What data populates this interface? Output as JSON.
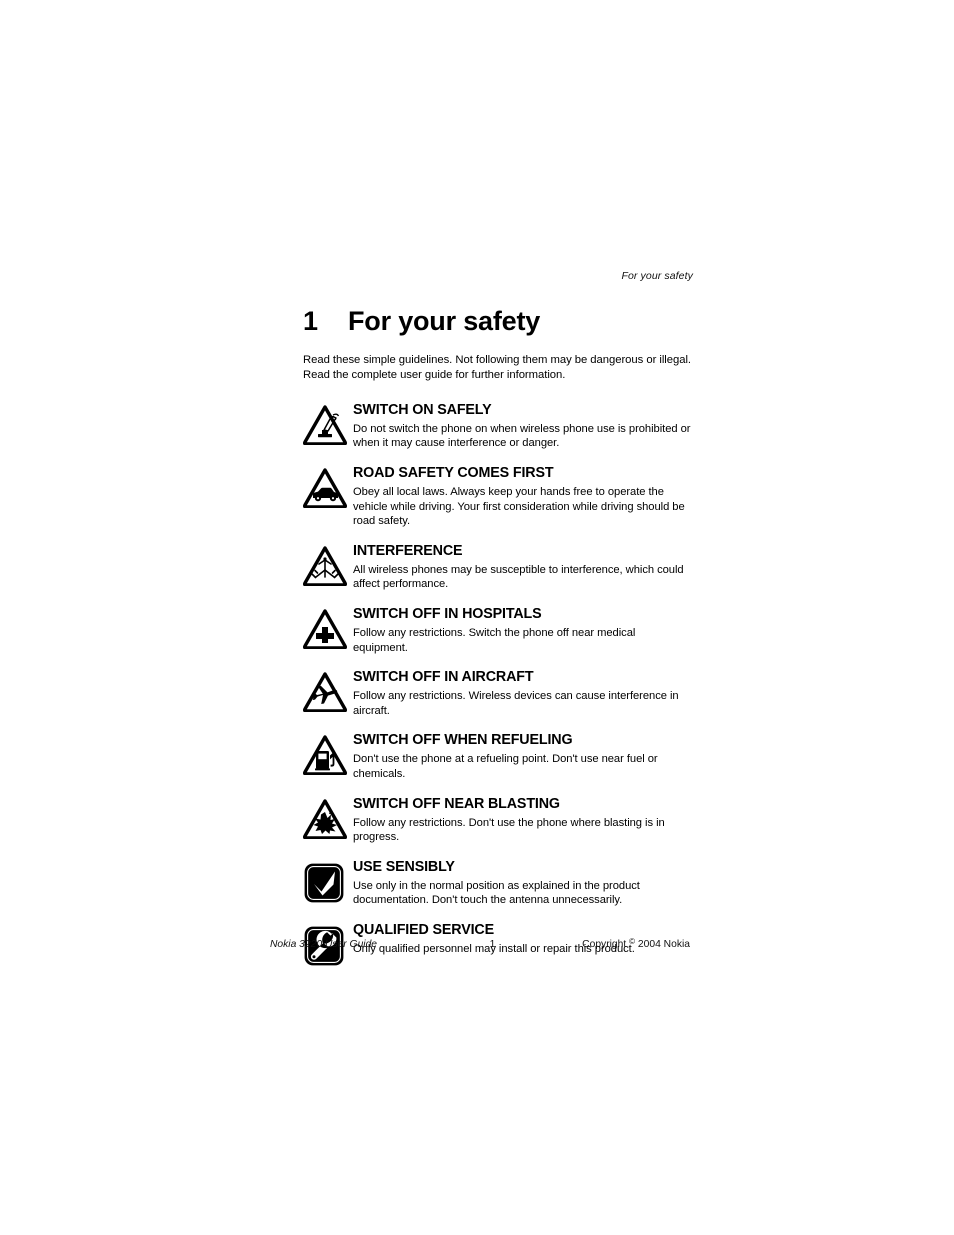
{
  "running_header": "For your safety",
  "chapter": {
    "number": "1",
    "title": "For your safety"
  },
  "intro": "Read these simple guidelines. Not following them may be dangerous or illegal. Read the complete user guide for further information.",
  "safety_items": [
    {
      "icon": "triangle-phone-hand-icon",
      "heading": "SWITCH ON SAFELY",
      "body": "Do not switch the phone on when wireless phone use is prohibited or when it may cause interference or danger."
    },
    {
      "icon": "triangle-car-icon",
      "heading": "ROAD SAFETY COMES FIRST",
      "body": "Obey all local laws. Always keep your hands free to operate the vehicle while driving. Your first consideration while driving should be road safety."
    },
    {
      "icon": "triangle-antenna-interference-icon",
      "heading": "INTERFERENCE",
      "body": "All wireless phones may be susceptible to interference, which could affect performance."
    },
    {
      "icon": "triangle-medical-cross-icon",
      "heading": "SWITCH OFF IN HOSPITALS",
      "body": "Follow any restrictions. Switch the phone off near medical equipment."
    },
    {
      "icon": "triangle-airplane-icon",
      "heading": "SWITCH OFF IN AIRCRAFT",
      "body": "Follow any restrictions. Wireless devices can cause interference in aircraft."
    },
    {
      "icon": "triangle-fuel-pump-icon",
      "heading": "SWITCH OFF WHEN REFUELING",
      "body": "Don't use the phone at a refueling point. Don't use near fuel or chemicals."
    },
    {
      "icon": "triangle-explosion-icon",
      "heading": "SWITCH OFF NEAR BLASTING",
      "body": "Follow any restrictions. Don't use the phone where blasting is in progress."
    },
    {
      "icon": "square-checkmark-icon",
      "heading": "USE SENSIBLY",
      "body": "Use only in the normal position as explained in the product documentation. Don't touch the antenna unnecessarily."
    },
    {
      "icon": "square-wrench-icon",
      "heading": "QUALIFIED SERVICE",
      "body": "Only qualified personnel may install or repair this product."
    }
  ],
  "footer": {
    "left": "Nokia 3220 User Guide",
    "page_number": "1",
    "copyright_prefix": "Copyright",
    "copyright_symbol": "©",
    "copyright_suffix": "2004 Nokia"
  },
  "colors": {
    "page_background": "#ffffff",
    "text": "#000000"
  }
}
